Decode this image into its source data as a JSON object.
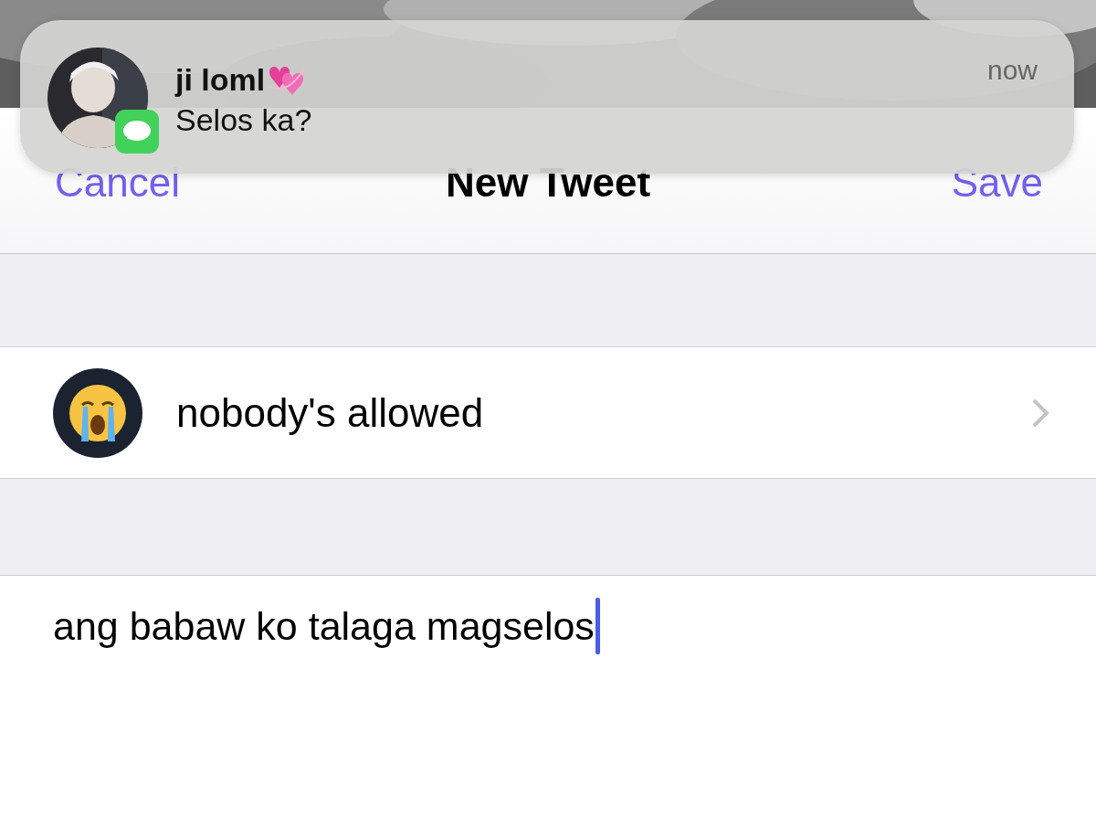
{
  "notification": {
    "sender": "ji loml",
    "message": "Selos ka?",
    "time": "now"
  },
  "nav": {
    "cancel": "Cancel",
    "title": "New Tweet",
    "save": "Save"
  },
  "rows": [
    {
      "label": "nobody's allowed"
    }
  ],
  "tweet": {
    "value": "ang babaw ko talaga magselos"
  }
}
